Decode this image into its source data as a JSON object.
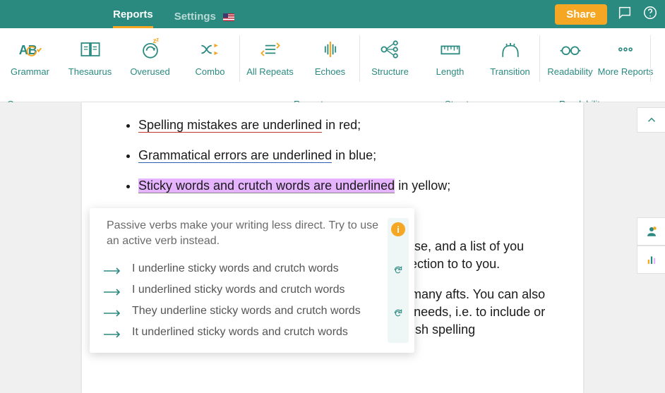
{
  "topbar": {
    "tabs": {
      "reports": "Reports",
      "settings": "Settings"
    },
    "share": "Share"
  },
  "toolbar": {
    "items": {
      "grammar": "Grammar",
      "thesaurus": "Thesaurus",
      "overused": "Overused",
      "combo": "Combo",
      "allrepeats": "All Repeats",
      "echoes": "Echoes",
      "structure": "Structure",
      "length": "Length",
      "transition": "Transition",
      "readability": "Readability",
      "more": "More Reports"
    },
    "groups": {
      "core": "Core",
      "repeats": "Repeats",
      "structure": "Structure",
      "readability": "Readability"
    }
  },
  "doc": {
    "bullets": {
      "b1a": "Spelling mistakes are underlined",
      "b1b": " in red;",
      "b2a": "Grammatical errors are underlined",
      "b2b": " in blue;",
      "b3a": "Sticky words and crutch words are underlined",
      "b3b": " in yellow;"
    },
    "para1": "word or phrase, and a list of you make a correction to to you.",
    "para2": "rms and for many afts. You can also update your needs, i.e. to include or to follow British spelling"
  },
  "suggest": {
    "tip": "Passive verbs make your writing less direct. Try to use an active verb instead.",
    "opts": [
      "I underline sticky words and crutch words",
      "I underlined sticky words and crutch words",
      "They underline sticky words and crutch words",
      "It underlined sticky words and crutch words"
    ],
    "info": "i"
  }
}
